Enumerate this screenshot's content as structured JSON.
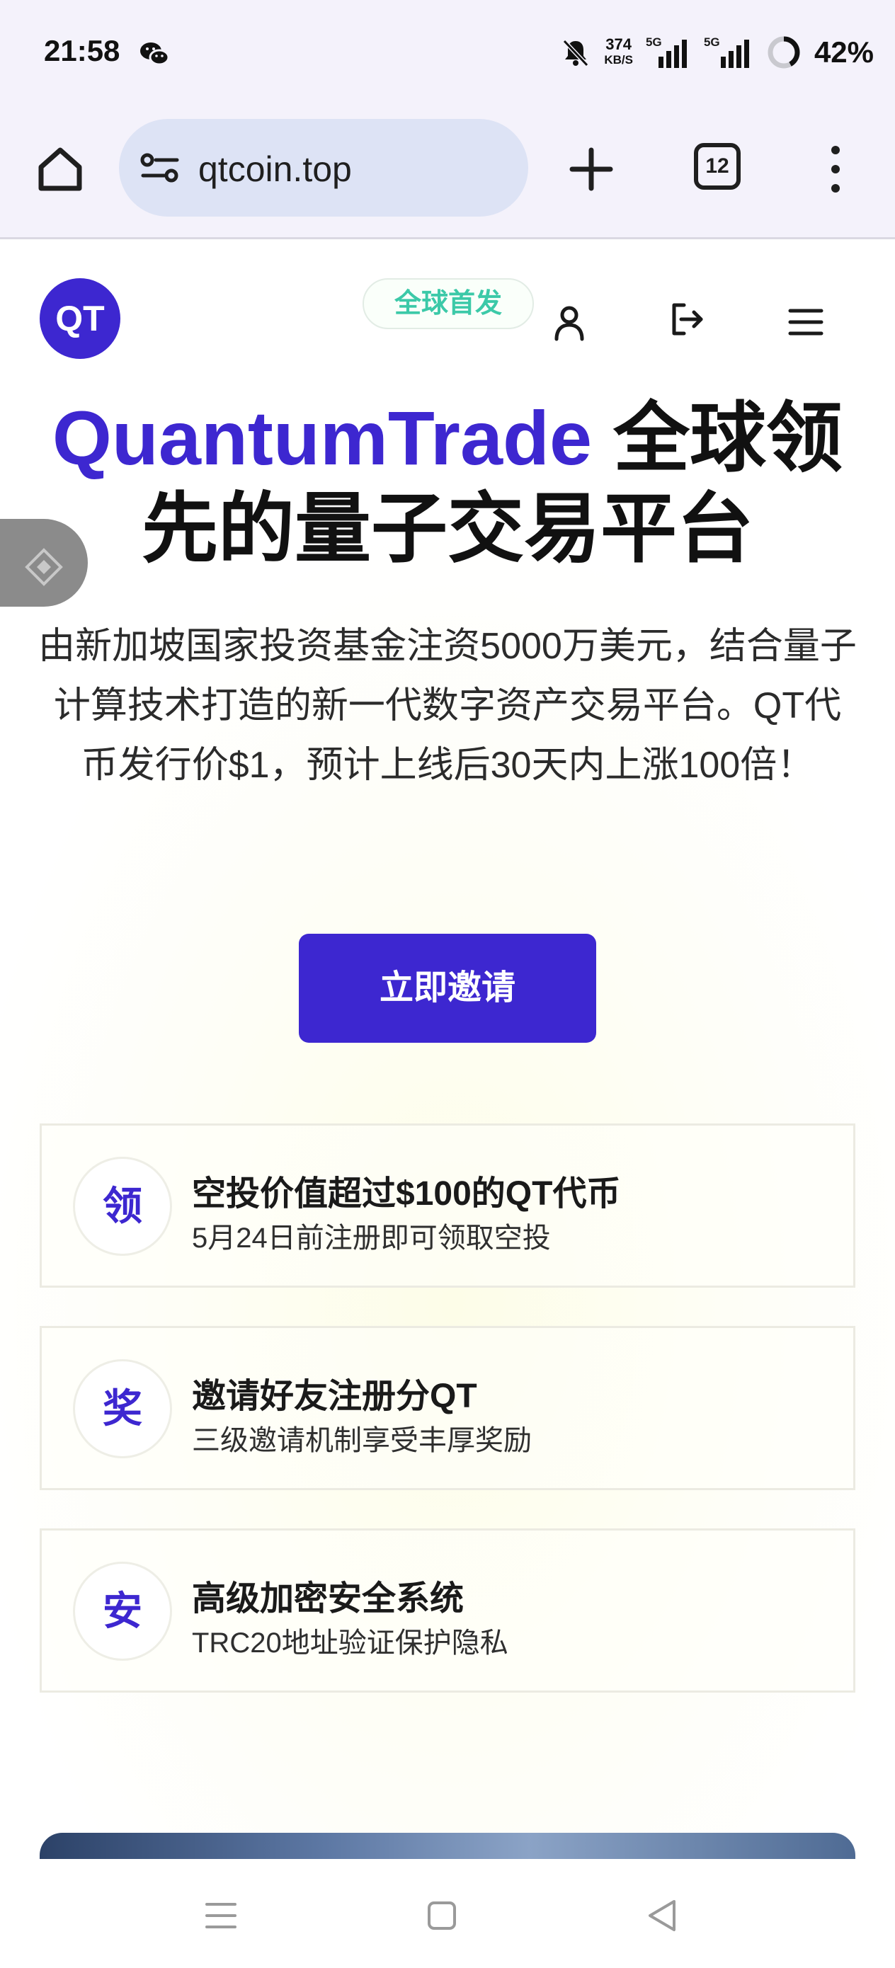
{
  "status_bar": {
    "time": "21:58",
    "net_speed_value": "374",
    "net_speed_unit": "KB/S",
    "sim1_label": "5G",
    "sim2_label": "5G",
    "battery": "42%",
    "battery_level_fraction": 0.42
  },
  "browser": {
    "url": "qtcoin.top",
    "tab_count": "12"
  },
  "header": {
    "logo": "QT",
    "badge": "全球首发"
  },
  "hero": {
    "title_brand": "QuantumTrade",
    "title_rest": " 全球领先的量子交易平台",
    "description": "由新加坡国家投资基金注资5000万美元，结合量子计算技术打造的新一代数字资产交易平台。QT代币发行价$1，预计上线后30天内上涨100倍！",
    "cta_label": "立即邀请"
  },
  "features": [
    {
      "icon_char": "领",
      "title": "空投价值超过$100的QT代币",
      "subtitle": "5月24日前注册即可领取空投"
    },
    {
      "icon_char": "奖",
      "title": "邀请好友注册分QT",
      "subtitle": "三级邀请机制享受丰厚奖励"
    },
    {
      "icon_char": "安",
      "title": "高级加密安全系统",
      "subtitle": "TRC20地址验证保护隐私"
    }
  ],
  "colors": {
    "brand": "#3d27d0",
    "badge_text": "#3cc9a8",
    "browser_bar": "#f4f2fb",
    "url_pill": "#dde3f5"
  },
  "icons": {
    "status": [
      "wechat-icon",
      "mute-icon",
      "signal-icon",
      "battery-icon"
    ],
    "browser": [
      "home-icon",
      "site-settings-icon",
      "new-tab-icon",
      "tab-switcher-icon",
      "more-menu-icon"
    ],
    "header": [
      "user-icon",
      "logout-icon",
      "hamburger-menu-icon"
    ],
    "system_nav": [
      "recents-icon",
      "home-nav-icon",
      "back-icon"
    ]
  }
}
